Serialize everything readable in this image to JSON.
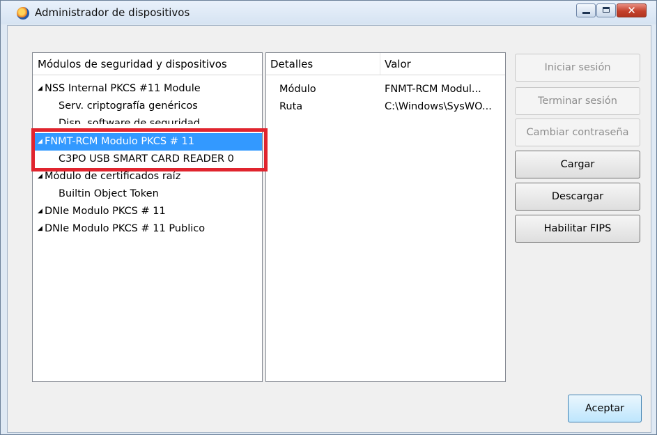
{
  "window": {
    "title": "Administrador de dispositivos",
    "close_glyph": "✕"
  },
  "tree": {
    "header": "Módulos de seguridad y dispositivos",
    "expand_glyph": "◢",
    "rows": [
      {
        "label": "NSS Internal PKCS #11 Module"
      },
      {
        "label": "Serv. criptografía genéricos"
      },
      {
        "label": "Disp. software de seguridad"
      },
      {
        "label": "FNMT-RCM Modulo PKCS # 11"
      },
      {
        "label": "C3PO USB SMART CARD READER 0"
      },
      {
        "label": "Módulo de certificados raíz"
      },
      {
        "label": "Builtin Object Token"
      },
      {
        "label": "DNIe Modulo PKCS # 11"
      },
      {
        "label": "DNIe Modulo PKCS # 11 Publico"
      }
    ]
  },
  "details": {
    "header_detail": "Detalles",
    "header_value": "Valor",
    "rows": [
      {
        "label": "Módulo",
        "value": "FNMT-RCM Modul..."
      },
      {
        "label": "Ruta",
        "value": "C:\\Windows\\SysWO..."
      }
    ]
  },
  "buttons": {
    "login": "Iniciar sesión",
    "logout": "Terminar sesión",
    "change_password": "Cambiar contraseña",
    "load": "Cargar",
    "unload": "Descargar",
    "enable_fips": "Habilitar FIPS",
    "accept": "Aceptar"
  },
  "colors": {
    "selection": "#3399ff",
    "highlight_box": "#e0242e"
  }
}
